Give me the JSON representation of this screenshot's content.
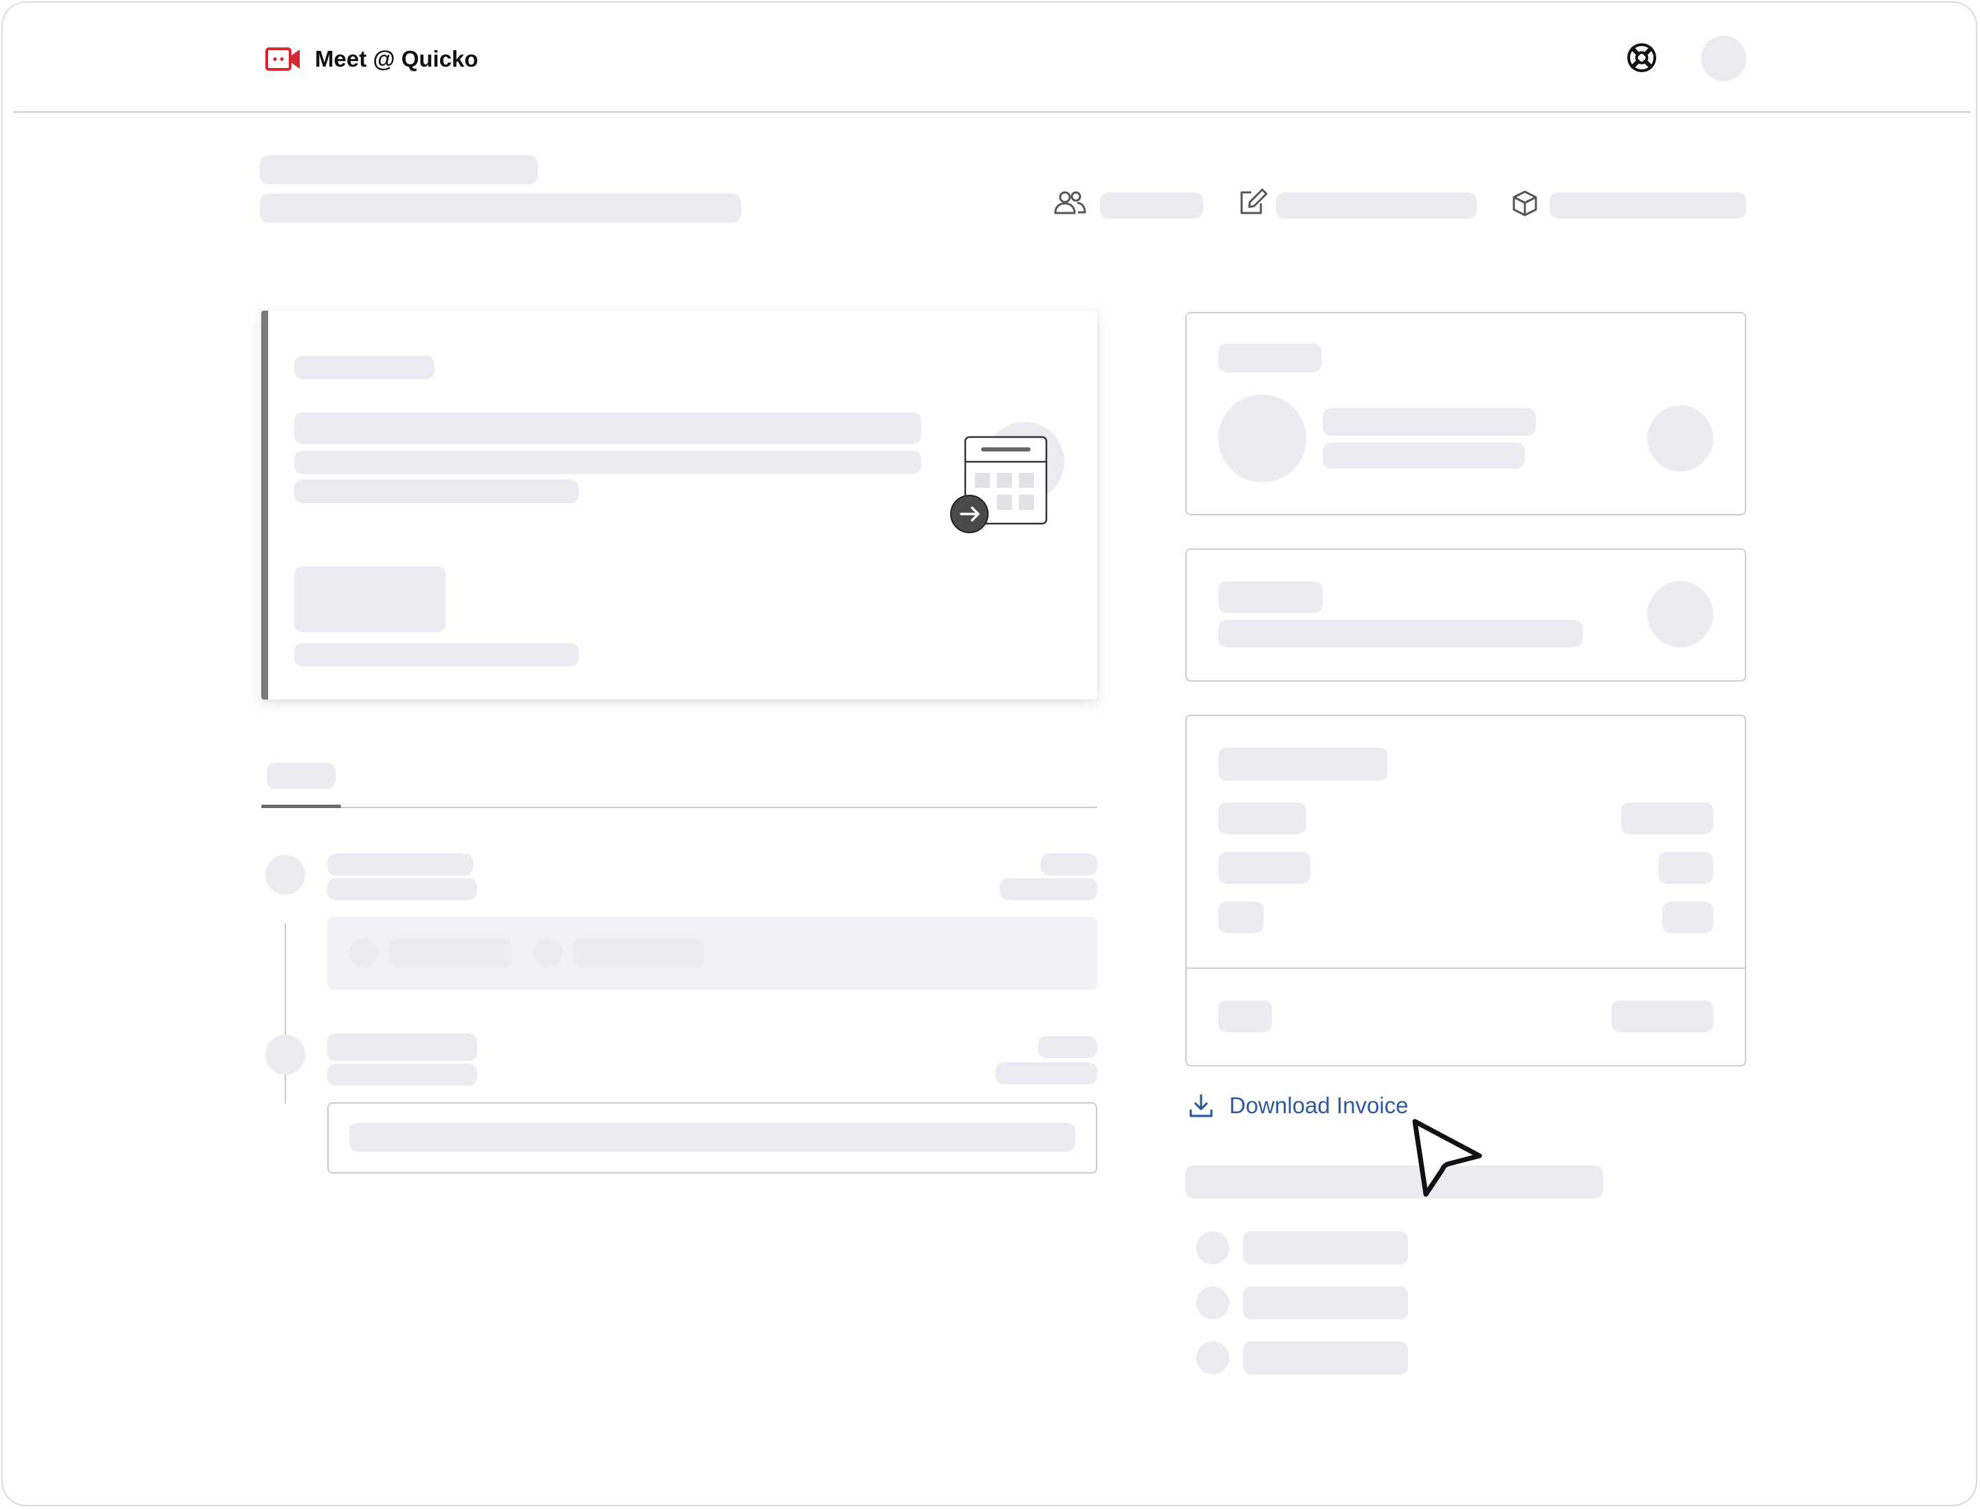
{
  "header": {
    "app_title": "Meet @ Quicko",
    "icons": {
      "logo": "video-camera-icon",
      "help": "lifebuoy-icon"
    }
  },
  "meta_icons": [
    "users-icon",
    "edit-icon",
    "box-icon"
  ],
  "colors": {
    "brand_red": "#d6262e",
    "link_blue": "#2f5a9b",
    "skeleton": "#ebebf2",
    "border": "#cdcdd2",
    "text_dark": "#111111"
  },
  "actions": {
    "download_invoice_label": "Download Invoice",
    "download_icon": "download-icon"
  },
  "pointer_icon": "mouse-pointer-icon"
}
